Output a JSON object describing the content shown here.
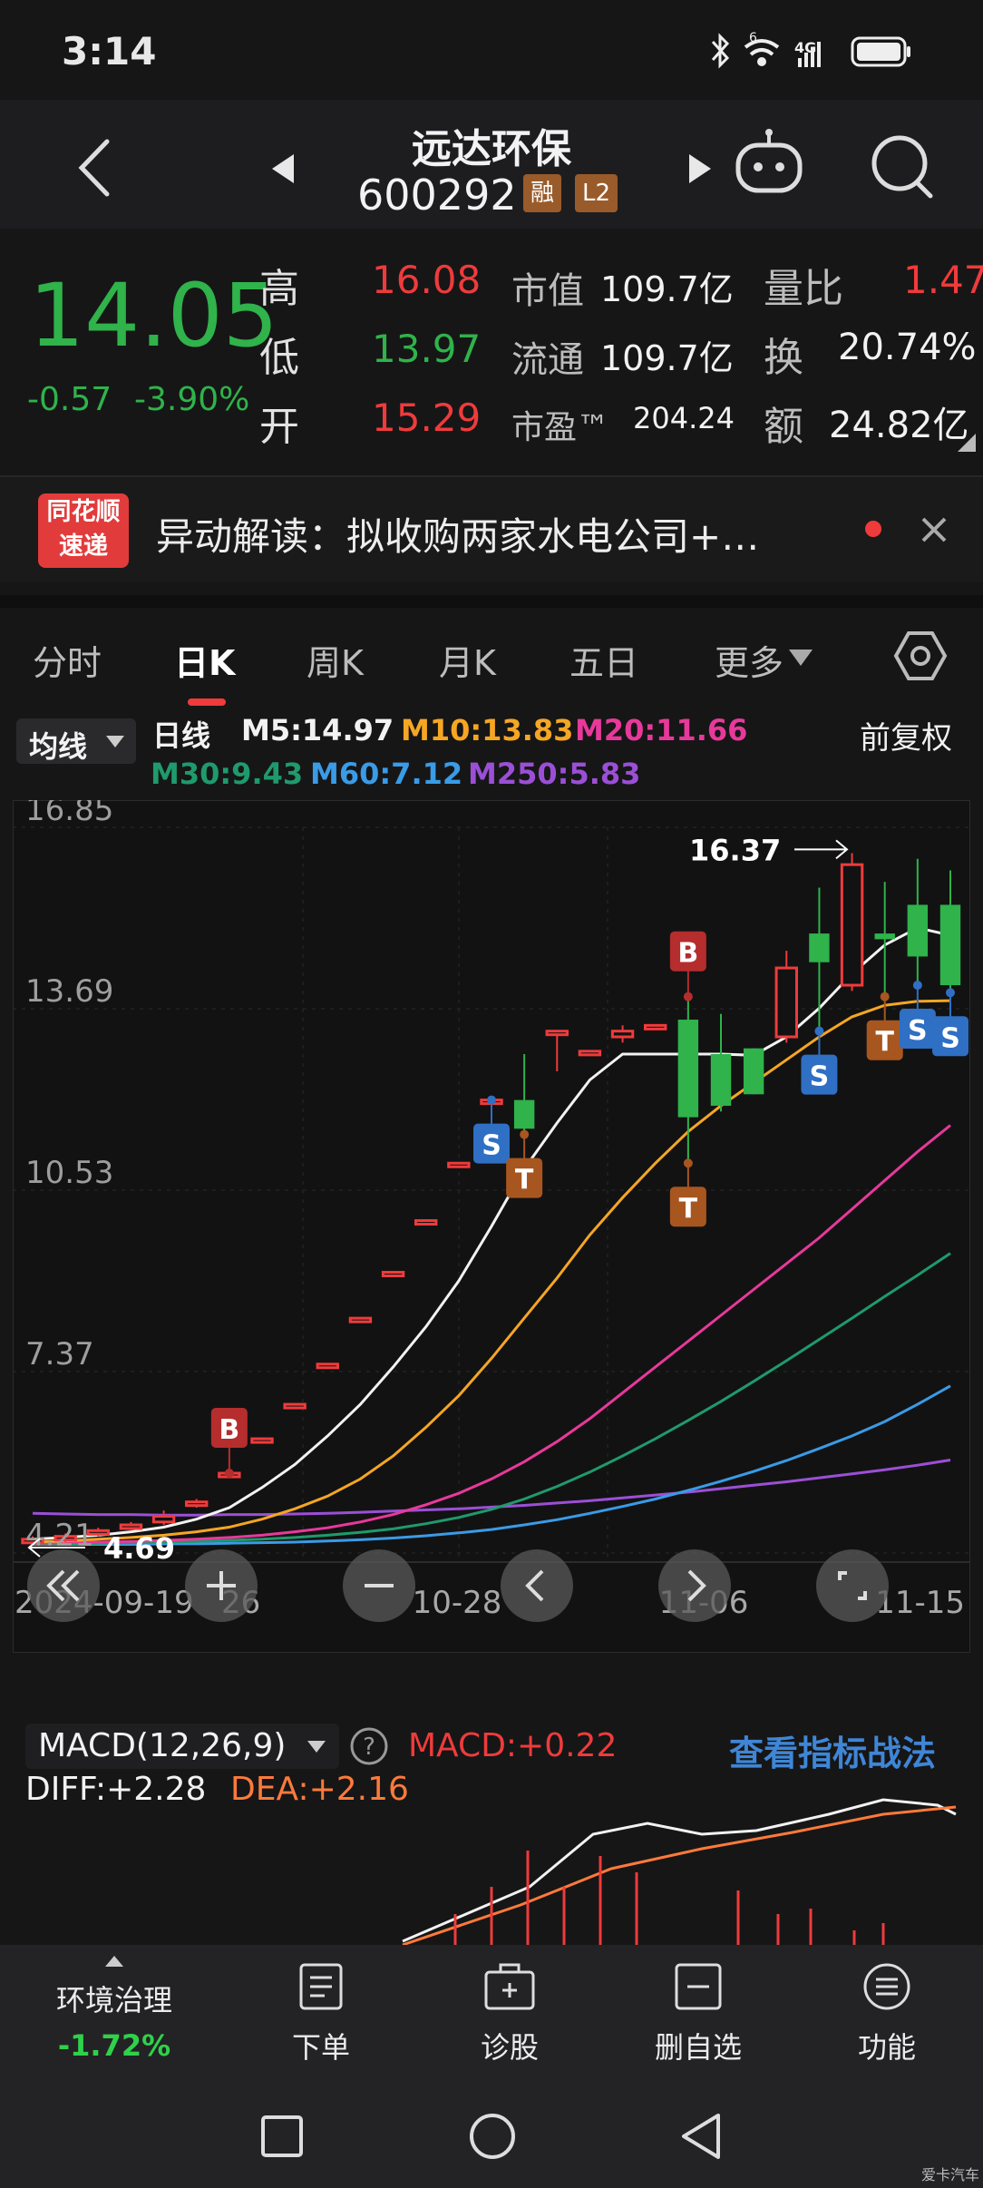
{
  "status_bar": {
    "time": "3:14",
    "network": "4G",
    "signal": "6"
  },
  "header": {
    "stock_name": "远达环保",
    "stock_code": "600292",
    "tag_margin": "融",
    "tag_level": "L2"
  },
  "quote": {
    "price": "14.05",
    "change": "-0.57",
    "change_pct": "-3.90%",
    "high_label": "高",
    "high": "16.08",
    "low_label": "低",
    "low": "13.97",
    "open_label": "开",
    "open": "15.29",
    "mktcap_label": "市值",
    "mktcap": "109.7亿",
    "float_label": "流通",
    "float": "109.7亿",
    "pe_label": "市盈™",
    "pe": "204.24",
    "vol_ratio_label": "量比",
    "vol_ratio": "1.47",
    "turnover_label": "换",
    "turnover": "20.74%",
    "amount_label": "额",
    "amount": "24.82亿"
  },
  "news": {
    "logo_line1": "同花顺",
    "logo_line2": "速递",
    "text": "异动解读：拟收购两家水电公司+…"
  },
  "tabs": [
    "分时",
    "日K",
    "周K",
    "月K",
    "五日",
    "更多"
  ],
  "ma_bar": {
    "selector": "均线",
    "period": "日线",
    "adjust": "前复权",
    "items": [
      {
        "label": "M5:14.97",
        "color": "#f2f2f2"
      },
      {
        "label": "M10:13.83",
        "color": "#f5a623"
      },
      {
        "label": "M20:11.66",
        "color": "#e8399b"
      },
      {
        "label": "M30:9.43",
        "color": "#1f9a6c"
      },
      {
        "label": "M60:7.12",
        "color": "#3a9be6"
      },
      {
        "label": "M250:5.83",
        "color": "#9b4fd6"
      }
    ]
  },
  "chart_data": {
    "type": "candlestick",
    "y_ticks": [
      "16.85",
      "13.69",
      "10.53",
      "7.37",
      "4.21"
    ],
    "ylim": [
      4.21,
      16.85
    ],
    "x_ticks": [
      "2024-09-19",
      "26",
      "10-28",
      "11-06",
      "11-15"
    ],
    "high_marker": "16.37",
    "low_marker": "4.69",
    "signals": [
      "B",
      "B",
      "S",
      "T",
      "T",
      "S",
      "T",
      "S",
      "S"
    ],
    "candles": [
      {
        "o": 4.4,
        "c": 4.45,
        "h": 4.5,
        "l": 4.35
      },
      {
        "o": 4.45,
        "c": 4.5,
        "h": 4.55,
        "l": 4.4
      },
      {
        "o": 4.55,
        "c": 4.6,
        "h": 4.65,
        "l": 4.5
      },
      {
        "o": 4.65,
        "c": 4.7,
        "h": 4.75,
        "l": 4.6
      },
      {
        "o": 4.75,
        "c": 4.85,
        "h": 4.95,
        "l": 4.7
      },
      {
        "o": 5.05,
        "c": 5.1,
        "h": 5.15,
        "l": 5.0
      },
      {
        "o": 5.55,
        "c": 5.6,
        "h": 5.6,
        "l": 5.55
      },
      {
        "o": 6.2,
        "c": 6.2,
        "h": 6.2,
        "l": 6.2
      },
      {
        "o": 6.8,
        "c": 6.8,
        "h": 6.8,
        "l": 6.8
      },
      {
        "o": 7.5,
        "c": 7.5,
        "h": 7.5,
        "l": 7.5
      },
      {
        "o": 8.3,
        "c": 8.3,
        "h": 8.3,
        "l": 8.3
      },
      {
        "o": 9.1,
        "c": 9.1,
        "h": 9.1,
        "l": 9.1
      },
      {
        "o": 10.0,
        "c": 10.0,
        "h": 10.0,
        "l": 10.0
      },
      {
        "o": 11.0,
        "c": 11.0,
        "h": 11.0,
        "l": 11.0
      },
      {
        "o": 12.1,
        "c": 12.1,
        "h": 12.1,
        "l": 12.1
      },
      {
        "o": 12.1,
        "c": 11.6,
        "h": 12.9,
        "l": 11.5
      },
      {
        "o": 13.3,
        "c": 13.3,
        "h": 13.3,
        "l": 12.6
      },
      {
        "o": 12.95,
        "c": 12.95,
        "h": 12.95,
        "l": 12.95
      },
      {
        "o": 13.2,
        "c": 13.3,
        "h": 13.4,
        "l": 13.1
      },
      {
        "o": 13.4,
        "c": 13.4,
        "h": 13.4,
        "l": 13.4
      },
      {
        "o": 13.5,
        "c": 11.8,
        "h": 13.9,
        "l": 11.0
      },
      {
        "o": 12.9,
        "c": 12.0,
        "h": 13.6,
        "l": 11.9
      },
      {
        "o": 13.0,
        "c": 12.2,
        "h": 13.0,
        "l": 12.2
      },
      {
        "o": 13.2,
        "c": 14.4,
        "h": 14.7,
        "l": 13.1
      },
      {
        "o": 15.0,
        "c": 14.5,
        "h": 15.8,
        "l": 13.3
      },
      {
        "o": 14.1,
        "c": 16.2,
        "h": 16.4,
        "l": 14.0
      },
      {
        "o": 15.0,
        "c": 14.9,
        "h": 15.9,
        "l": 13.9
      },
      {
        "o": 15.5,
        "c": 14.6,
        "h": 16.3,
        "l": 14.1
      },
      {
        "o": 15.5,
        "c": 14.1,
        "h": 16.1,
        "l": 13.97
      }
    ],
    "ma5": [
      4.45,
      4.48,
      4.52,
      4.58,
      4.66,
      4.8,
      5.0,
      5.35,
      5.75,
      6.25,
      6.8,
      7.45,
      8.15,
      8.95,
      9.9,
      10.9,
      11.7,
      12.45,
      12.9,
      12.9,
      12.9,
      12.9,
      12.88,
      13.2,
      13.7,
      14.3,
      14.8,
      15.1,
      14.97
    ],
    "ma10": [
      4.4,
      4.42,
      4.45,
      4.48,
      4.52,
      4.58,
      4.66,
      4.8,
      4.98,
      5.2,
      5.5,
      5.9,
      6.4,
      6.95,
      7.6,
      8.3,
      9.0,
      9.75,
      10.4,
      11.0,
      11.55,
      12.0,
      12.4,
      12.8,
      13.2,
      13.55,
      13.75,
      13.82,
      13.83
    ],
    "ma20": [
      4.38,
      4.39,
      4.4,
      4.41,
      4.43,
      4.45,
      4.48,
      4.52,
      4.58,
      4.65,
      4.75,
      4.88,
      5.05,
      5.25,
      5.5,
      5.8,
      6.15,
      6.55,
      7.0,
      7.45,
      7.9,
      8.35,
      8.8,
      9.25,
      9.7,
      10.2,
      10.7,
      11.2,
      11.66
    ],
    "ma30": [
      4.37,
      4.37,
      4.38,
      4.39,
      4.4,
      4.41,
      4.43,
      4.45,
      4.48,
      4.52,
      4.57,
      4.63,
      4.72,
      4.83,
      4.97,
      5.15,
      5.37,
      5.62,
      5.9,
      6.2,
      6.52,
      6.85,
      7.2,
      7.56,
      7.93,
      8.3,
      8.68,
      9.05,
      9.43
    ],
    "ma60": [
      4.36,
      4.36,
      4.36,
      4.36,
      4.37,
      4.37,
      4.38,
      4.39,
      4.4,
      4.42,
      4.44,
      4.47,
      4.51,
      4.56,
      4.62,
      4.7,
      4.79,
      4.9,
      5.02,
      5.15,
      5.3,
      5.46,
      5.63,
      5.82,
      6.03,
      6.25,
      6.5,
      6.8,
      7.12
    ],
    "ma250": [
      4.9,
      4.89,
      4.88,
      4.88,
      4.87,
      4.87,
      4.88,
      4.88,
      4.89,
      4.9,
      4.92,
      4.94,
      4.96,
      4.98,
      5.01,
      5.04,
      5.08,
      5.12,
      5.17,
      5.22,
      5.27,
      5.33,
      5.39,
      5.45,
      5.52,
      5.59,
      5.66,
      5.74,
      5.83
    ]
  },
  "macd": {
    "label": "MACD(12,26,9)",
    "value_label": "MACD:+0.22",
    "diff": "DIFF:+2.28",
    "dea": "DEA:+2.16",
    "link": "查看指标战法"
  },
  "bottom_nav": {
    "sector_name": "环境治理",
    "sector_change": "-1.72%",
    "items": [
      "下单",
      "诊股",
      "删自选",
      "功能"
    ]
  },
  "watermark": "爱卡汽车"
}
